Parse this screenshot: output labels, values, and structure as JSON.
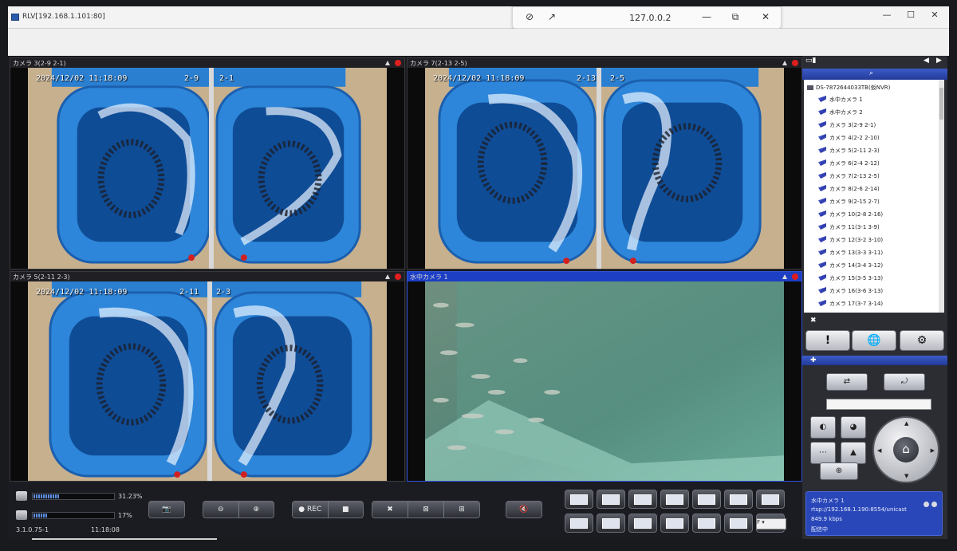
{
  "window": {
    "title": "RLV[192.168.1.101:80]",
    "controls": [
      "—",
      "☐",
      "✕"
    ]
  },
  "remote_bar": {
    "title": "127.0.0.2",
    "controls": [
      "—",
      "⧉",
      "✕"
    ]
  },
  "panes": [
    {
      "label": "カメラ 3(2-9 2-1)",
      "osd_time": "2024/12/02 11:18:09",
      "osd_left": "2-9",
      "osd_right": "2-1",
      "active": false
    },
    {
      "label": "カメラ 7(2-13 2-5)",
      "osd_time": "2024/12/02 11:18:09",
      "osd_left": "2-13",
      "osd_right": "2-5",
      "active": false
    },
    {
      "label": "カメラ 5(2-11 2-3)",
      "osd_time": "2024/12/02 11:18:09",
      "osd_left": "2-11",
      "osd_right": "2-3",
      "active": false
    },
    {
      "label": "水中カメラ 1",
      "osd_time": "",
      "osd_left": "",
      "osd_right": "",
      "active": true
    }
  ],
  "device_tree": {
    "root": "DS-7872644033TB(仮NVR)",
    "items": [
      "水中カメラ 1",
      "水中カメラ 2",
      "カメラ 3(2-9 2-1)",
      "カメラ 4(2-2 2-10)",
      "カメラ 5(2-11 2-3)",
      "カメラ 6(2-4 2-12)",
      "カメラ 7(2-13 2-5)",
      "カメラ 8(2-6 2-14)",
      "カメラ 9(2-15 2-7)",
      "カメラ 10(2-8 2-16)",
      "カメラ 11(3-1 3-9)",
      "カメラ 12(3-2 3-10)",
      "カメラ 13(3-3 3-11)",
      "カメラ 14(3-4 3-12)",
      "カメラ 15(3-5 3-13)",
      "カメラ 16(3-6 3-13)",
      "カメラ 17(3-7 3-14)"
    ]
  },
  "sidebar_buttons": {
    "alarm": "!",
    "globe": "🌐",
    "config": "⚙"
  },
  "info": {
    "camera": "水中カメラ 1",
    "stream": "rtsp://192.168.1.190:8554/unicast",
    "bitrate": "849.9 kbps",
    "status": "配信中"
  },
  "status": {
    "hdd_percent": "31.23%",
    "cpu_percent": "17%",
    "hdd_fill": 31.23,
    "cpu_fill": 17,
    "version": "3.1.0.75-1",
    "clock": "11:18:08"
  },
  "toolbar": {
    "rec_label": "● REC",
    "stop_label": "■",
    "close_label": "✖",
    "close_all_label": "⊠",
    "add_label": "⊞"
  },
  "layout_select": {
    "value": "F"
  }
}
